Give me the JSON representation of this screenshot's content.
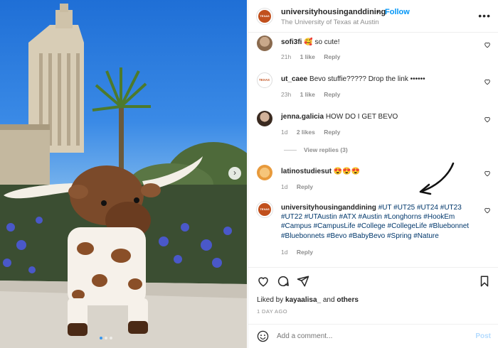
{
  "header": {
    "username": "universityhousinganddining",
    "separator": "•",
    "follow_label": "Follow",
    "subtitle": "The University of Texas at Austin",
    "more_label": "•••"
  },
  "photo": {
    "description_icon": "longhorn-plush-photo",
    "carousel_count": 3,
    "carousel_active": 1
  },
  "comments": [
    {
      "username": "sofi3fi",
      "text": "🥰 so cute!",
      "time": "21h",
      "likes": "1 like",
      "reply": "Reply"
    },
    {
      "username": "ut_caee",
      "text": "Bevo stuffie????? Drop the link ••••••",
      "time": "23h",
      "likes": "1 like",
      "reply": "Reply"
    },
    {
      "username": "jenna.galicia",
      "text": "HOW DO I GET BEVO",
      "time": "1d",
      "likes": "2 likes",
      "reply": "Reply",
      "view_replies": "View replies (3)"
    },
    {
      "username": "latinostudiesut",
      "text": "😍😍😍",
      "time": "1d",
      "reply": "Reply"
    },
    {
      "username": "universityhousinganddining",
      "text": "#UT #UT25 #UT24 #UT23 #UT22 #UTAustin #ATX #Austin #Longhorns #HookEm #Campus #CampusLife #College #CollegeLife #Bluebonnet #Bluebonnets #Bevo #BabyBevo #Spring #Nature",
      "time": "1d",
      "reply": "Reply"
    }
  ],
  "actions": {
    "liked_prefix": "Liked by",
    "liked_user": "kayaalisa_",
    "liked_and": "and",
    "liked_others": "others",
    "timestamp": "1 DAY AGO"
  },
  "add_comment": {
    "placeholder": "Add a comment...",
    "post_label": "Post"
  },
  "colors": {
    "link_blue": "#0095f6",
    "hashtag": "#00376b",
    "muted": "#8e8e8e",
    "brand_orange": "#c1501d"
  }
}
